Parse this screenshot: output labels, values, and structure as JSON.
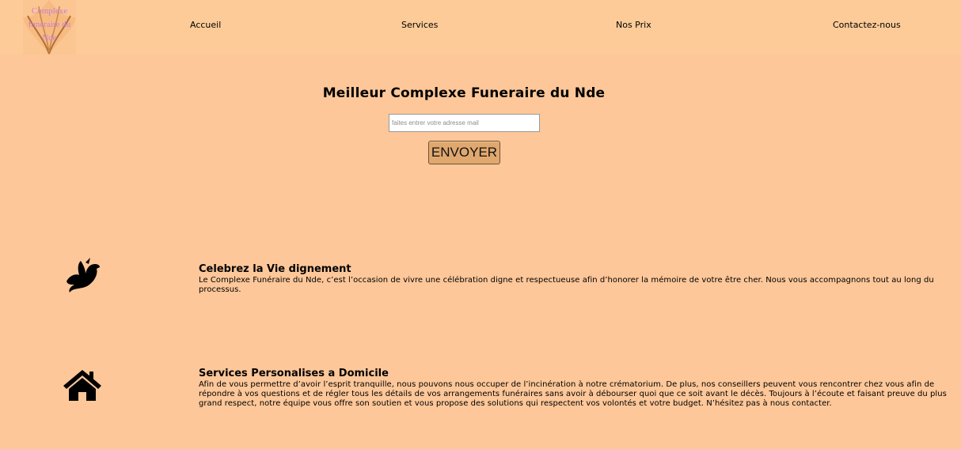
{
  "header": {
    "logo_text": "Complexe funeraire du Nde",
    "nav": [
      "Accueil",
      "Services",
      "Nos Prix",
      "Contactez-nous"
    ]
  },
  "hero": {
    "title": "Meilleur Complexe Funeraire du Nde",
    "email_placeholder": "faites entrer votre adresse mail",
    "email_value": "",
    "send_label": "ENVOYER"
  },
  "features": [
    {
      "icon": "dove-icon",
      "title": "Celebrez la Vie dignement",
      "text": "Le Complexe Funéraire du Nde, c’est l’occasion de vivre une célébration digne et respectueuse afin d’honorer la mémoire de votre être cher. Nous vous accompagnons tout au long du processus."
    },
    {
      "icon": "house-icon",
      "title": "Services Personalises a Domicile",
      "text": "Afin de vous permettre d’avoir l’esprit tranquille, nous pouvons nous occuper de l’incinération à notre crématorium. De plus, nos conseillers peuvent vous rencontrer chez vous afin de répondre à vos questions et de régler tous les détails de vos arrangements funéraires sans avoir à débourser quoi que ce soit avant le décès. Toujours à l’écoute et faisant preuve du plus grand respect, notre équipe vous offre son soutien et vous propose des solutions qui respectent vos volontés et votre budget. N’hésitez pas à nous contacter."
    }
  ],
  "colors": {
    "background": "#fdc799",
    "button": "#e0a86f",
    "logo_text": "#c77dd8"
  }
}
